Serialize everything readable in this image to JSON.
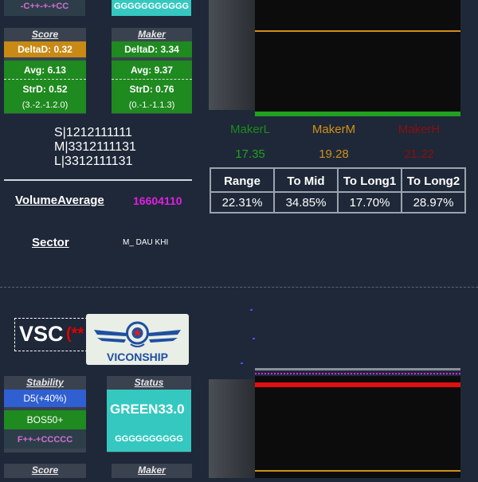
{
  "top": {
    "strip_left": "-C++-+-+CC",
    "strip_right": "GGGGGGGGGGG",
    "score": {
      "header": "Score",
      "delta": "DeltaD: 0.32",
      "avg": "Avg: 6.13",
      "strd": "StrD: 0.52",
      "range": "(3.-2.-1.2.0)"
    },
    "maker": {
      "header": "Maker",
      "delta": "DeltaD: 3.34",
      "avg": "Avg: 9.37",
      "strd": "StrD: 0.76",
      "range": "(0.-1.-1.1.3)"
    },
    "sml": [
      "S|1212111111",
      "M|3312111131",
      "L|3312111131"
    ],
    "volume_label": "VolumeAverage",
    "volume_value": "16604110",
    "sector_label": "Sector",
    "sector_value": "M_ DAU KHI",
    "makers": {
      "l_label": "MakerL",
      "l_value": "17.35",
      "m_label": "MakerM",
      "m_value": "19.28",
      "h_label": "MakerH",
      "h_value": "21.22"
    },
    "stats": {
      "headers": [
        "Range",
        "To Mid",
        "To Long1",
        "To Long2"
      ],
      "values": [
        "22.31%",
        "34.85%",
        "17.70%",
        "28.97%"
      ]
    }
  },
  "bottom": {
    "ticker": "VSC",
    "ticker_suffix": "(**",
    "logo_text": "VICONSHIP",
    "stability": {
      "header": "Stability",
      "d5": "D5(+40%)",
      "bos": "BOS50+",
      "strip": "F++-+CCCCC"
    },
    "status": {
      "header": "Status",
      "value": "GREEN33.0",
      "strip": "GGGGGGGGGG"
    },
    "score_header": "Score",
    "maker_header": "Maker"
  },
  "colors": {
    "background": "#1e2838",
    "green": "#1f8a1f",
    "orange": "#c88a14",
    "blue": "#2f5fd0",
    "teal": "#35c8c0",
    "magenta": "#e020e0",
    "maker_l": "#22a022",
    "maker_m": "#d09018",
    "maker_h": "#8a1010"
  }
}
